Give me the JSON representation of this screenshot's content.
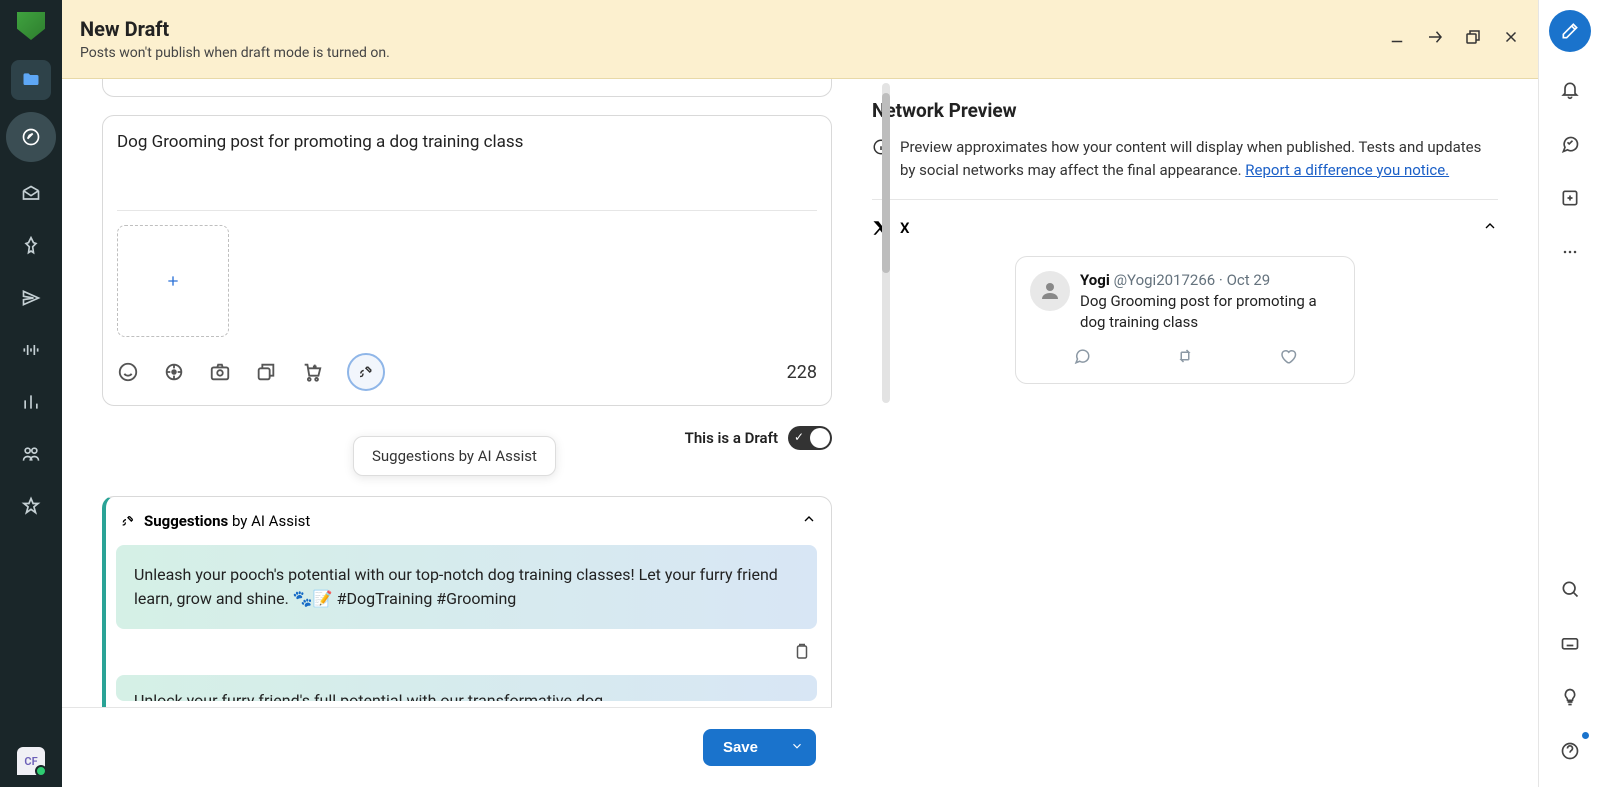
{
  "header": {
    "title": "New Draft",
    "subtitle": "Posts won't publish when draft mode is turned on."
  },
  "compose": {
    "text": "Dog Grooming post for promoting a dog training class",
    "char_count": "228",
    "tooltip": "Suggestions by AI Assist",
    "draft_label": "This is a Draft"
  },
  "suggestions": {
    "heading_bold": "Suggestions",
    "heading_rest": " by AI Assist",
    "items": [
      "Unleash your pooch's potential with our top-notch dog training classes! Let your furry friend learn, grow and shine. 🐾📝 #DogTraining #Grooming",
      "Unlock your furry friend's full potential with our transformative dog"
    ]
  },
  "footer": {
    "save_label": "Save"
  },
  "preview": {
    "title": "Network Preview",
    "note": "Preview approximates how your content will display when published. Tests and updates by social networks may affect the final appearance. ",
    "report_link": "Report a difference you notice.",
    "network_label": "X",
    "tweet": {
      "name": "Yogi",
      "handle": "@Yogi2017266",
      "sep": " · ",
      "date": "Oct 29",
      "body": "Dog Grooming post for promoting a dog training class"
    }
  },
  "sidebar_left": {
    "badge": "CF"
  }
}
